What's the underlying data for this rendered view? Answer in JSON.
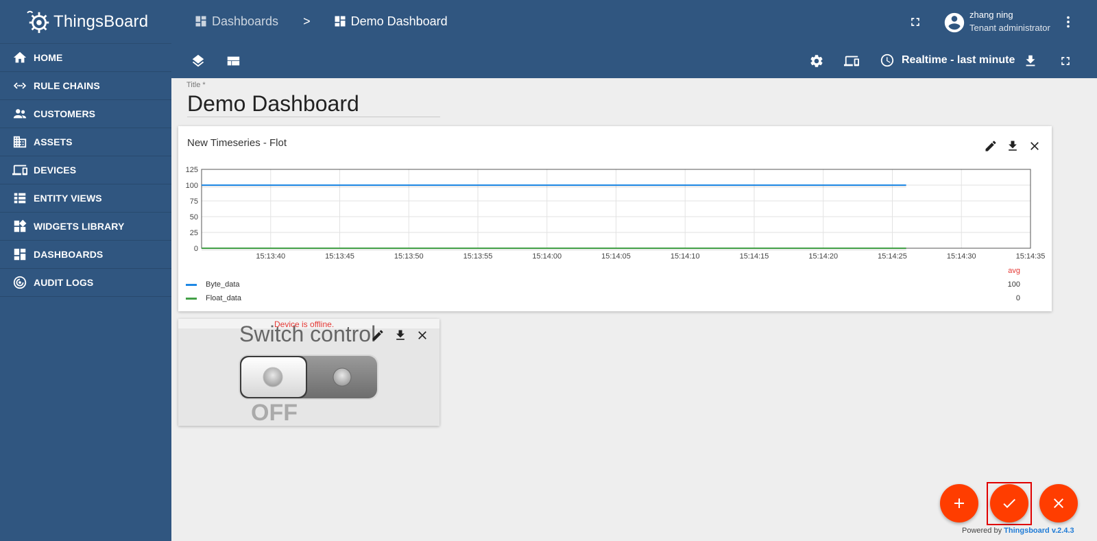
{
  "brand": {
    "name": "ThingsBoard"
  },
  "sidebar": {
    "items": [
      {
        "label": "HOME",
        "icon": "home-icon"
      },
      {
        "label": "RULE CHAINS",
        "icon": "rule-chains-icon"
      },
      {
        "label": "CUSTOMERS",
        "icon": "customers-icon"
      },
      {
        "label": "ASSETS",
        "icon": "assets-icon"
      },
      {
        "label": "DEVICES",
        "icon": "devices-icon"
      },
      {
        "label": "ENTITY VIEWS",
        "icon": "entity-views-icon"
      },
      {
        "label": "WIDGETS LIBRARY",
        "icon": "widgets-library-icon"
      },
      {
        "label": "DASHBOARDS",
        "icon": "dashboards-icon"
      },
      {
        "label": "AUDIT LOGS",
        "icon": "audit-logs-icon"
      }
    ]
  },
  "header": {
    "breadcrumb": {
      "parent": "Dashboards",
      "separator": ">",
      "current": "Demo Dashboard"
    },
    "user": {
      "name": "zhang ning",
      "role": "Tenant administrator"
    },
    "timewindow": "Realtime - last minute"
  },
  "title_field": {
    "label": "Title *",
    "value": "Demo Dashboard"
  },
  "widget_timeseries": {
    "title": "New Timeseries - Flot",
    "legend_header": "avg",
    "legend": [
      {
        "name": "Byte_data",
        "avg": "100",
        "color": "#1e88e5"
      },
      {
        "name": "Float_data",
        "avg": "0",
        "color": "#43a047"
      }
    ]
  },
  "chart_data": {
    "type": "line",
    "x": [
      "15:13:35",
      "15:14:26"
    ],
    "xticks": [
      "15:13:40",
      "15:13:45",
      "15:13:50",
      "15:13:55",
      "15:14:00",
      "15:14:05",
      "15:14:10",
      "15:14:15",
      "15:14:20",
      "15:14:25",
      "15:14:30",
      "15:14:35"
    ],
    "series": [
      {
        "name": "Byte_data",
        "values": [
          100,
          100
        ],
        "color": "#1e88e5"
      },
      {
        "name": "Float_data",
        "values": [
          0,
          0
        ],
        "color": "#43a047"
      }
    ],
    "ylim": [
      0,
      125
    ],
    "yticks": [
      0,
      25,
      50,
      75,
      100,
      125
    ],
    "xlim": [
      "15:13:35",
      "15:14:35"
    ],
    "grid": true
  },
  "widget_switch": {
    "title": "Switch control",
    "status": "Device is offline.",
    "state": "OFF"
  },
  "footer": {
    "powered_by": "Powered by",
    "product": "Thingsboard v.2.4.3"
  },
  "colors": {
    "primary": "#305680",
    "accent": "#ff3d00",
    "background": "#eeeeee"
  }
}
